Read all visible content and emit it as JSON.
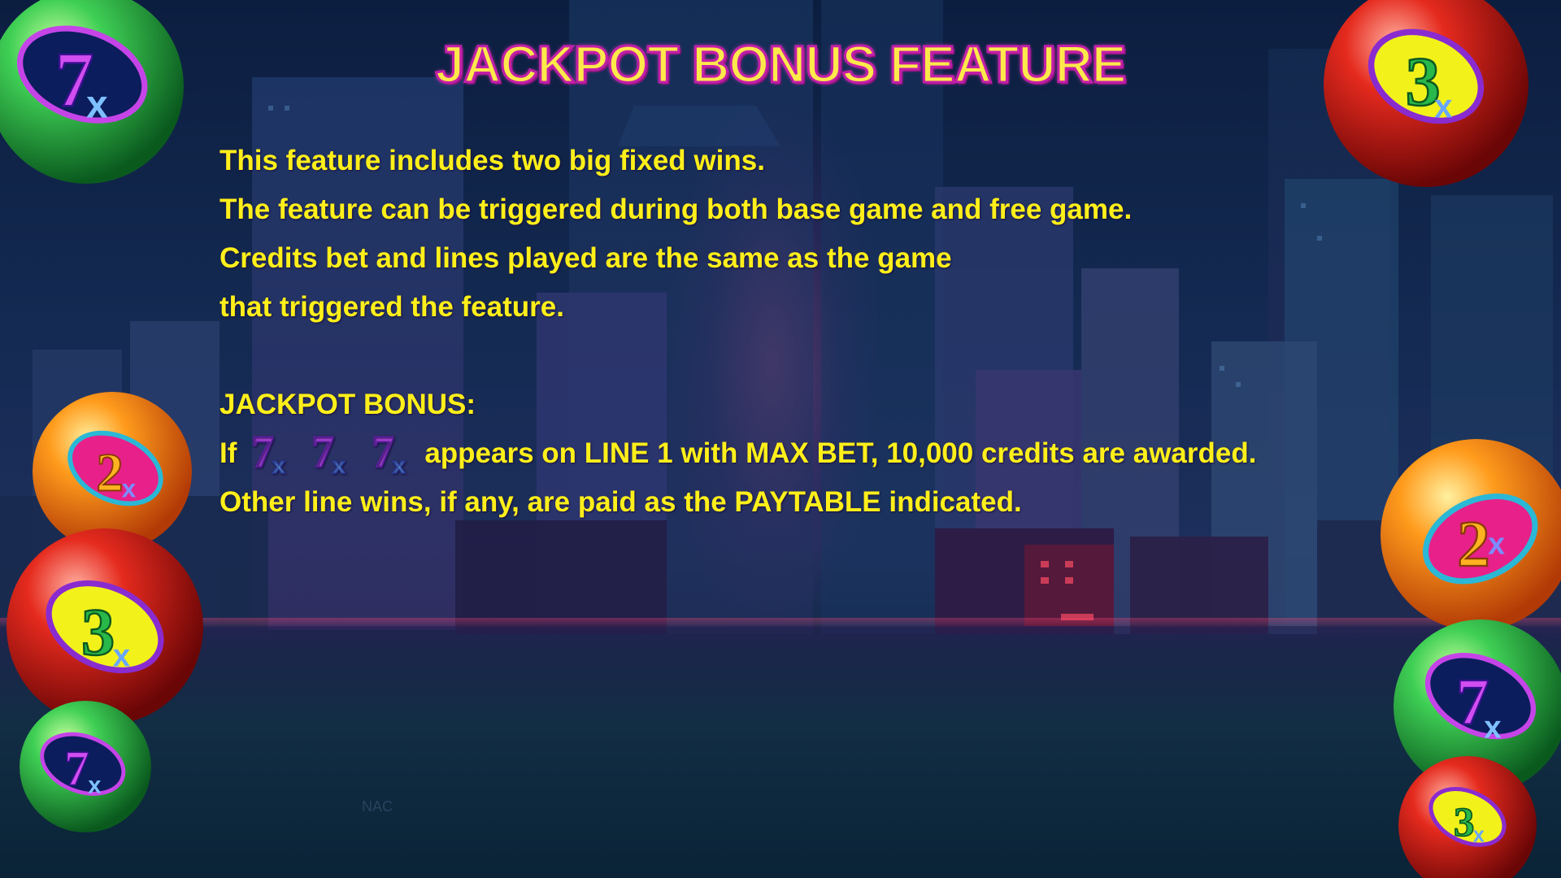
{
  "title": "JACKPOT BONUS FEATURE",
  "intro_lines": [
    "This feature includes two big fixed wins.",
    "The feature can be triggered during both base game and free game.",
    "Credits bet and lines played are the same as the game",
    "that triggered the feature."
  ],
  "jackpot_heading": "JACKPOT BONUS:",
  "jackpot_line_prefix": "If",
  "jackpot_line_suffix": "appears on LINE 1 with MAX BET, 10,000 credits are awarded.",
  "other_wins_line": "Other line wins, if any, are paid as the PAYTABLE indicated.",
  "reflection_text": "NAC",
  "colors": {
    "text": "#ffef1a",
    "title_fill": "#ffe94a",
    "title_outline": "#c21fa8",
    "ball_green": "#2fb24a",
    "ball_red": "#d81c14",
    "ball_orange": "#ff9a1a"
  },
  "symbols": {
    "seven_x": {
      "digit": "7",
      "mult": "x",
      "icon": "seven-x-symbol-icon"
    },
    "three_x": {
      "digit": "3",
      "mult": "x",
      "icon": "three-x-symbol-icon"
    },
    "two_x": {
      "digit": "2",
      "mult": "x",
      "icon": "two-x-symbol-icon"
    }
  }
}
